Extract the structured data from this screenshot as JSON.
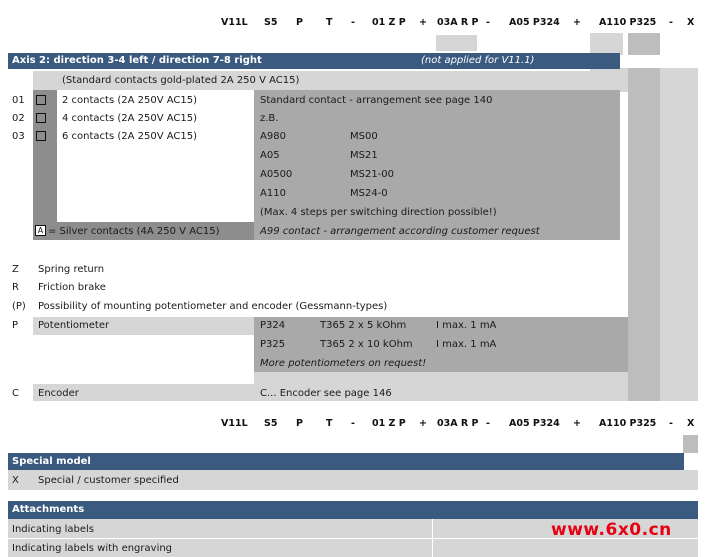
{
  "code_row": {
    "items": [
      "V11L",
      "S5",
      "P",
      "T",
      "-",
      "01 Z P",
      "+",
      "03A R P",
      "-",
      "A05 P324",
      "+",
      "A110 P325",
      "-",
      "X"
    ]
  },
  "axis_header": {
    "title": "Axis 2: direction 3-4 left / direction 7-8 right",
    "note": "(not applied for V11.1)"
  },
  "contacts": {
    "intro": "(Standard contacts gold-plated 2A 250 V AC15)",
    "rows": [
      {
        "code": "01",
        "label": "2 contacts (2A 250V AC15)"
      },
      {
        "code": "02",
        "label": "4 contacts (2A 250V AC15)"
      },
      {
        "code": "03",
        "label": "6 contacts (2A 250V AC15)"
      }
    ],
    "silver": {
      "box": "A",
      "label": "= Silver contacts (4A 250 V AC15)"
    }
  },
  "arrangement": {
    "heading": "Standard contact - arrangement see page 140",
    "zb": "z.B.",
    "pairs": [
      {
        "a": "A980",
        "b": "MS00"
      },
      {
        "a": "A05",
        "b": "MS21"
      },
      {
        "a": "A0500",
        "b": "MS21-00"
      },
      {
        "a": "A110",
        "b": "MS24-0"
      }
    ],
    "max_note": "(Max. 4 steps per switching direction possible!)",
    "a99": "A99 contact - arrangement according customer request"
  },
  "options": [
    {
      "code": "Z",
      "label": "Spring return"
    },
    {
      "code": "R",
      "label": "Friction brake"
    },
    {
      "code": "(P)",
      "label": "Possibility of mounting potentiometer and encoder (Gessmann-types)"
    }
  ],
  "potentiometer": {
    "code": "P",
    "label": "Potentiometer",
    "rows": [
      {
        "type": "P324",
        "spec": "T365 2 x 5 kOhm",
        "imax": "I max. 1 mA"
      },
      {
        "type": "P325",
        "spec": "T365 2 x 10 kOhm",
        "imax": "I max. 1 mA"
      }
    ],
    "more": "More potentiometers on request!"
  },
  "encoder": {
    "code": "C",
    "label": "Encoder",
    "ref": "C... Encoder see page 146"
  },
  "special_model": {
    "title": "Special model",
    "code": "X",
    "label": "Special / customer specified"
  },
  "attachments": {
    "title": "Attachments",
    "items": [
      "Indicating labels",
      "Indicating labels with engraving"
    ]
  },
  "watermark": "www.6x0.cn",
  "colors": {
    "header_bar": "#3a5a7f",
    "gray_light": "#d6d6d6",
    "gray_medium": "#bdbdbd",
    "gray_dark": "#a9a9a9",
    "watermark": "#e60012"
  }
}
